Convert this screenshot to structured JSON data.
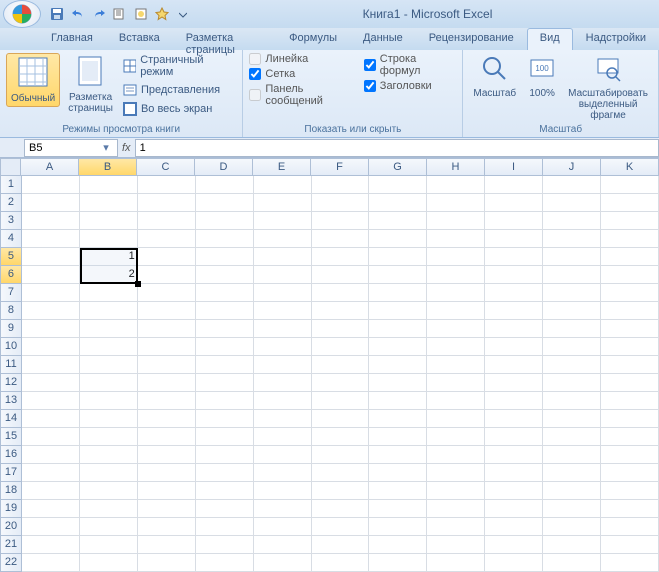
{
  "title": "Книга1 - Microsoft Excel",
  "qat": {
    "save": "save",
    "undo": "undo",
    "redo": "redo"
  },
  "tabs": [
    {
      "label": "Главная"
    },
    {
      "label": "Вставка"
    },
    {
      "label": "Разметка страницы"
    },
    {
      "label": "Формулы"
    },
    {
      "label": "Данные"
    },
    {
      "label": "Рецензирование"
    },
    {
      "label": "Вид",
      "active": true
    },
    {
      "label": "Надстройки"
    }
  ],
  "ribbon": {
    "views": {
      "normal": "Обычный",
      "page_layout": "Разметка\nстраницы",
      "page_break": "Страничный режим",
      "custom_views": "Представления",
      "full_screen": "Во весь экран",
      "group_label": "Режимы просмотра книги"
    },
    "show_hide": {
      "ruler": "Линейка",
      "gridlines": "Сетка",
      "message_bar": "Панель сообщений",
      "formula_bar": "Строка формул",
      "headings": "Заголовки",
      "group_label": "Показать или скрыть"
    },
    "zoom": {
      "zoom": "Масштаб",
      "hundred": "100%",
      "to_selection": "Масштабировать\nвыделенный фрагме",
      "group_label": "Масштаб"
    }
  },
  "namebox": "B5",
  "formula_value": "1",
  "columns": [
    "A",
    "B",
    "C",
    "D",
    "E",
    "F",
    "G",
    "H",
    "I",
    "J",
    "K"
  ],
  "rows": 22,
  "cells": {
    "B5": "1",
    "B6": "2"
  },
  "selection": {
    "col": "B",
    "row_start": 5,
    "row_end": 6
  }
}
